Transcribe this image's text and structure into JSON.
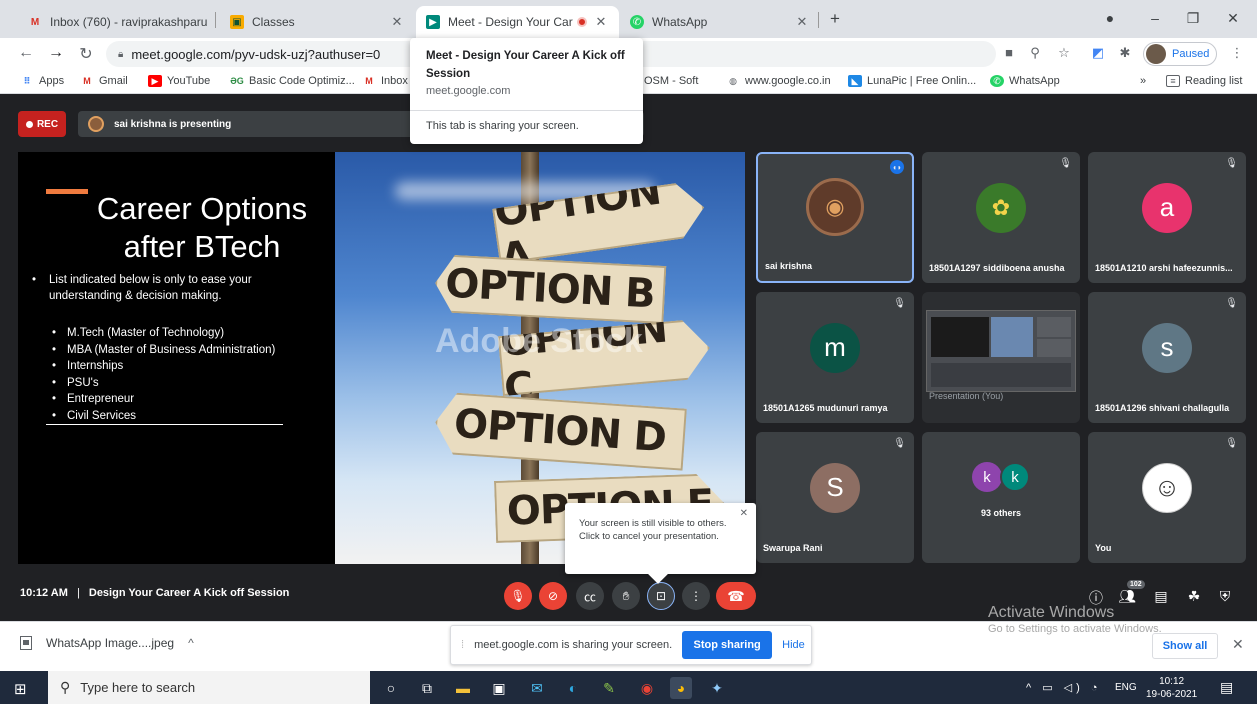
{
  "tabs": [
    {
      "title": "Inbox (760) - raviprakashparu",
      "icon": "gmail-icon"
    },
    {
      "title": "Classes",
      "icon": "classroom-icon"
    },
    {
      "title": "Meet - Design Your Care",
      "icon": "meet-icon",
      "active": true
    },
    {
      "title": "WhatsApp",
      "icon": "whatsapp-icon"
    }
  ],
  "address_bar": {
    "url": "meet.google.com/pyv-udsk-uzj?authuser=0"
  },
  "profile": {
    "label": "Paused"
  },
  "bookmarks": {
    "apps": "Apps",
    "items": [
      "Gmail",
      "YouTube",
      "Basic Code Optimiz...",
      "Inbox",
      "OSM - Soft",
      "www.google.co.in",
      "LunaPic | Free Onlin...",
      "WhatsApp"
    ],
    "more": "»",
    "reading_list": "Reading list"
  },
  "tab_popup": {
    "title": "Meet - Design Your Career A Kick off Session",
    "domain": "meet.google.com",
    "status": "This tab is sharing your screen."
  },
  "meet": {
    "rec_label": "REC",
    "presenting": "sai krishna is presenting",
    "slide": {
      "title_line1": "Career Options",
      "title_line2": "after BTech",
      "intro": "List indicated below is only to ease your understanding & decision making.",
      "bullets": [
        "M.Tech (Master of Technology)",
        "MBA (Master of Business Administration)",
        "Internships",
        "PSU's",
        "Entrepreneur",
        "Civil Services"
      ],
      "signs": [
        "OPTION A",
        "OPTION B",
        "OPTION C",
        "OPTION D",
        "OPTION E"
      ],
      "watermark": "Adobe Stock"
    },
    "participants": [
      {
        "name": "sai krishna",
        "avatar_type": "photo"
      },
      {
        "name": "18501A1297 siddiboena anusha",
        "avatar_type": "photo"
      },
      {
        "name": "18501A1210 arshi hafeezunnis...",
        "initial": "a",
        "color": "#e8336d"
      },
      {
        "name": "18501A1265 mudunuri ramya",
        "initial": "m",
        "color": "#0b5345"
      },
      {
        "name": "Presentation (You)",
        "avatar_type": "screen"
      },
      {
        "name": "18501A1296 shivani challagulla",
        "initial": "s",
        "color": "#5f7785"
      },
      {
        "name": "Swarupa Rani",
        "initial": "S",
        "color": "#8d6e63"
      },
      {
        "name": "93 others",
        "initials": [
          "k",
          "k"
        ]
      },
      {
        "name": "You",
        "avatar_type": "photo"
      }
    ],
    "time": "10:12 AM",
    "separator": "|",
    "meeting_title": "Design Your Career A Kick off Session",
    "people_count": "102",
    "still_visible": "Your screen is still visible to others. Click to cancel your presentation."
  },
  "activate": {
    "title": "Activate Windows",
    "subtitle": "Go to Settings to activate Windows."
  },
  "download": {
    "filename": "WhatsApp Image....jpeg",
    "sharing_msg": "meet.google.com is sharing your screen.",
    "stop": "Stop sharing",
    "hide": "Hide",
    "show_all": "Show all"
  },
  "taskbar": {
    "search_placeholder": "Type here to search",
    "lang": "ENG",
    "time": "10:12",
    "date": "19-06-2021"
  },
  "colors": {
    "accent": "#1a73e8",
    "danger": "#ea4335",
    "meet_bg": "#202124"
  }
}
